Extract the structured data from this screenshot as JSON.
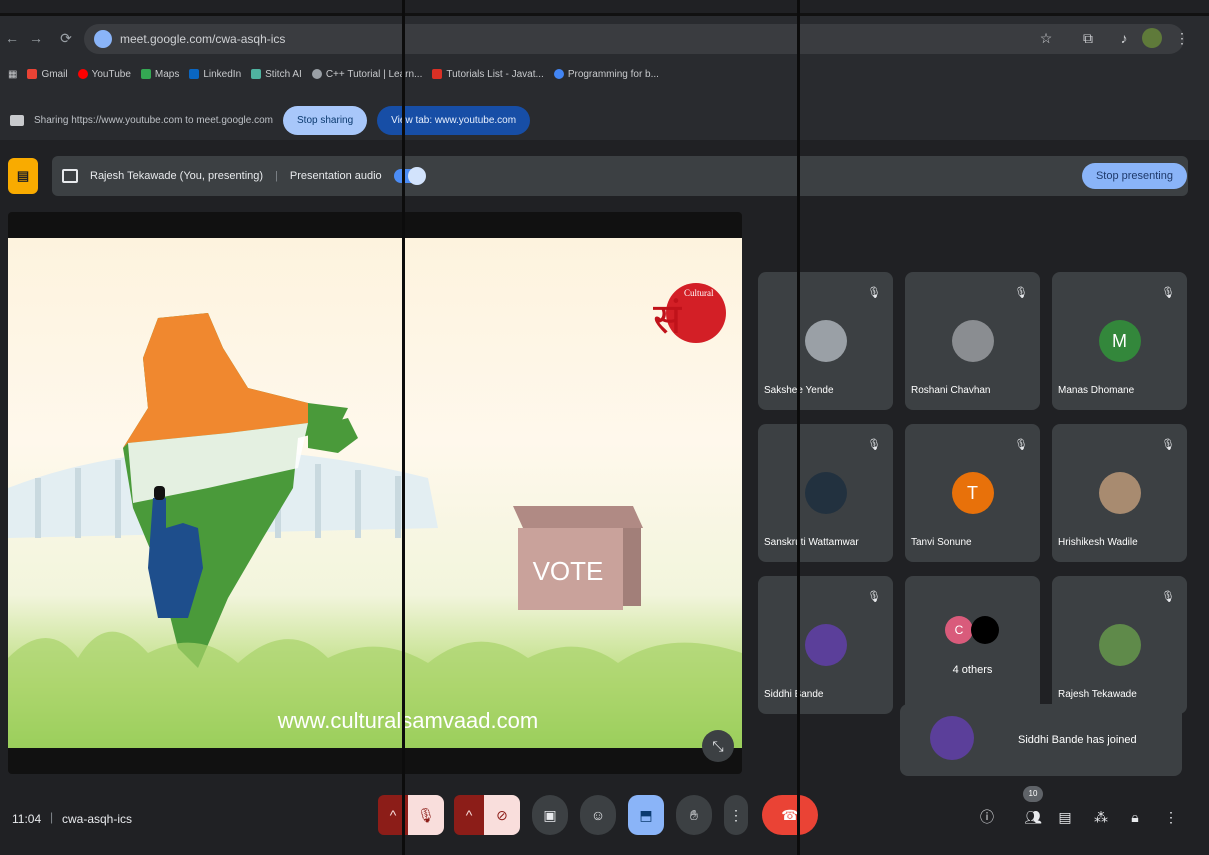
{
  "browser": {
    "url": "meet.google.com/cwa-asqh-ics",
    "bookmarks": [
      "Gmail",
      "YouTube",
      "Maps",
      "LinkedIn",
      "Stitch AI",
      "C++ Tutorial | Learn...",
      "Tutorials List - Javat...",
      "Programming for b..."
    ]
  },
  "share_bar": {
    "text": "Sharing https://www.youtube.com to meet.google.com",
    "stop_label": "Stop sharing",
    "view_label": "View tab: www.youtube.com"
  },
  "banner": {
    "presenter": "Rajesh Tekawade (You, presenting)",
    "audio_label": "Presentation audio",
    "stop_label": "Stop presenting"
  },
  "slide": {
    "vote_text": "VOTE",
    "url_text": "www.culturalsamvaad.com",
    "logo_small": "Cultural",
    "logo_big": "सं"
  },
  "participants": [
    {
      "name": "Sakshee Yende",
      "initial": "",
      "color": "#9aa0a6"
    },
    {
      "name": "Roshani Chavhan",
      "initial": "",
      "color": "#8a8d91"
    },
    {
      "name": "Manas Dhomane",
      "initial": "M",
      "color": "#33873b"
    },
    {
      "name": "Sanskruti Wattamwar",
      "initial": "",
      "color": "#22313f"
    },
    {
      "name": "Tanvi Sonune",
      "initial": "T",
      "color": "#e8710a"
    },
    {
      "name": "Hrishikesh Wadile",
      "initial": "",
      "color": "#a88b70"
    },
    {
      "name": "Siddhi Bande",
      "initial": "",
      "color": "#5b3f9a"
    },
    {
      "name": "4 others",
      "initial": "C",
      "color": "#d95b7b"
    },
    {
      "name": "Rajesh Tekawade",
      "initial": "",
      "color": "#5f8a4a"
    }
  ],
  "toast": {
    "text": "Siddhi Bande has joined"
  },
  "bottom": {
    "time": "11:04",
    "meeting_code": "cwa-asqh-ics",
    "badge": "10"
  },
  "colors": {
    "end_call": "#ea4335",
    "present_active": "#8ab4f8",
    "mic_off_bg": "#f9dedc"
  }
}
